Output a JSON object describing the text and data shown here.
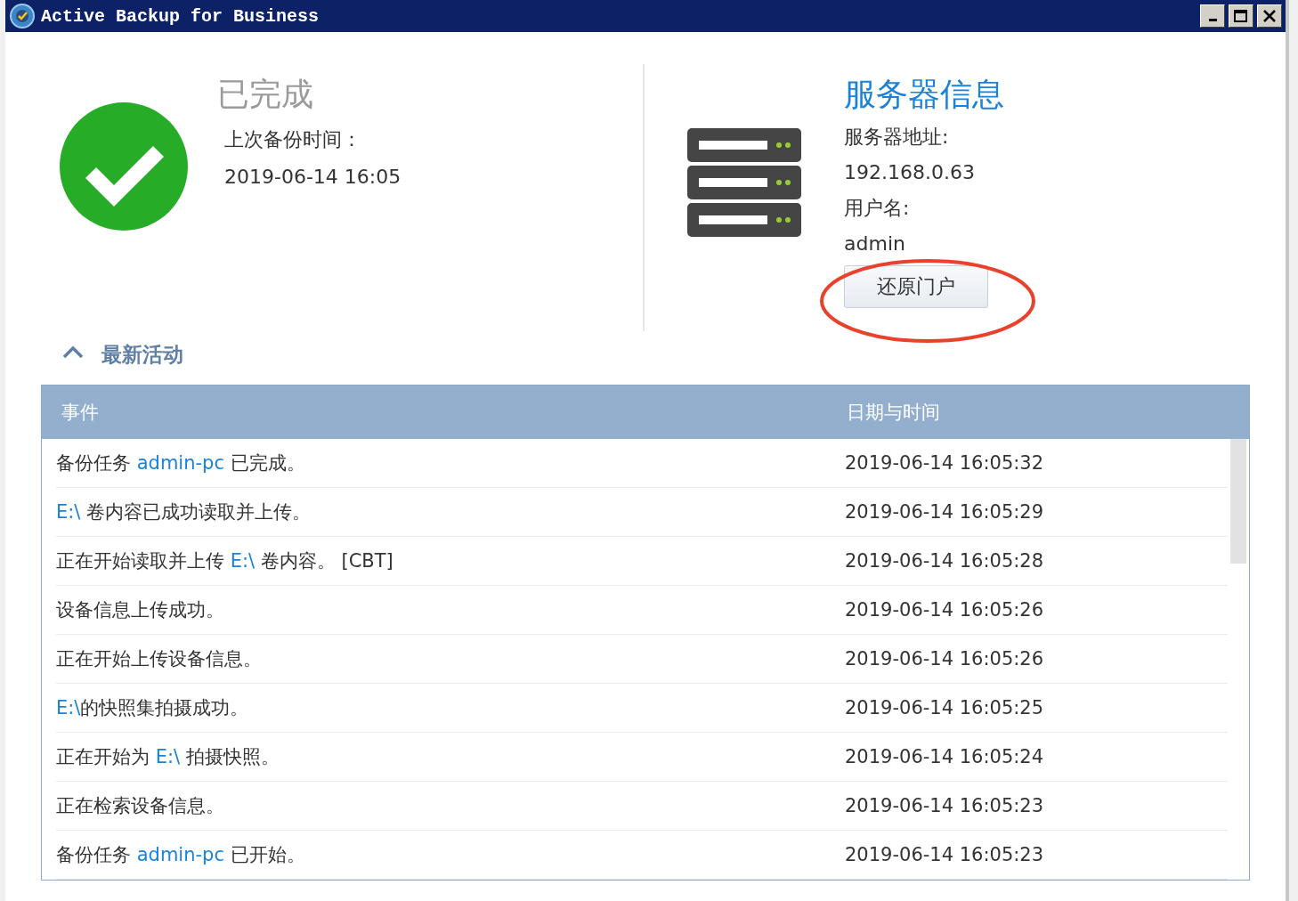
{
  "window": {
    "title": "Active Backup for Business"
  },
  "status": {
    "kind": "completed",
    "label": "已完成",
    "last_backup_label": "上次备份时间：",
    "last_backup_time": "2019-06-14 16:05"
  },
  "server": {
    "title": "服务器信息",
    "address_label": "服务器地址:",
    "address": "192.168.0.63",
    "username_label": "用户名:",
    "username": "admin",
    "button": "还原门户"
  },
  "activity": {
    "title": "最新活动",
    "expanded": true,
    "columns": [
      "事件",
      "日期与时间"
    ],
    "rows": [
      {
        "event": [
          {
            "kind": "text",
            "text": "备份任务 "
          },
          {
            "kind": "link",
            "text": "admin-pc"
          },
          {
            "kind": "text",
            "text": " 已完成。"
          }
        ],
        "time": "2019-06-14 16:05:32"
      },
      {
        "event": [
          {
            "kind": "link",
            "text": "E:\\"
          },
          {
            "kind": "text",
            "text": " 卷内容已成功读取并上传。"
          }
        ],
        "time": "2019-06-14 16:05:29"
      },
      {
        "event": [
          {
            "kind": "text",
            "text": "正在开始读取并上传 "
          },
          {
            "kind": "link",
            "text": "E:\\"
          },
          {
            "kind": "text",
            "text": " 卷内容。 [CBT]"
          }
        ],
        "time": "2019-06-14 16:05:28"
      },
      {
        "event": [
          {
            "kind": "text",
            "text": "设备信息上传成功。"
          }
        ],
        "time": "2019-06-14 16:05:26"
      },
      {
        "event": [
          {
            "kind": "text",
            "text": "正在开始上传设备信息。"
          }
        ],
        "time": "2019-06-14 16:05:26"
      },
      {
        "event": [
          {
            "kind": "link",
            "text": "E:\\"
          },
          {
            "kind": "text",
            "text": "的快照集拍摄成功。"
          }
        ],
        "time": "2019-06-14 16:05:25"
      },
      {
        "event": [
          {
            "kind": "text",
            "text": "正在开始为 "
          },
          {
            "kind": "link",
            "text": "E:\\"
          },
          {
            "kind": "text",
            "text": " 拍摄快照。"
          }
        ],
        "time": "2019-06-14 16:05:24"
      },
      {
        "event": [
          {
            "kind": "text",
            "text": "正在检索设备信息。"
          }
        ],
        "time": "2019-06-14 16:05:23"
      },
      {
        "event": [
          {
            "kind": "text",
            "text": "备份任务 "
          },
          {
            "kind": "link",
            "text": "admin-pc"
          },
          {
            "kind": "text",
            "text": " 已开始。"
          }
        ],
        "time": "2019-06-14 16:05:23"
      }
    ]
  }
}
